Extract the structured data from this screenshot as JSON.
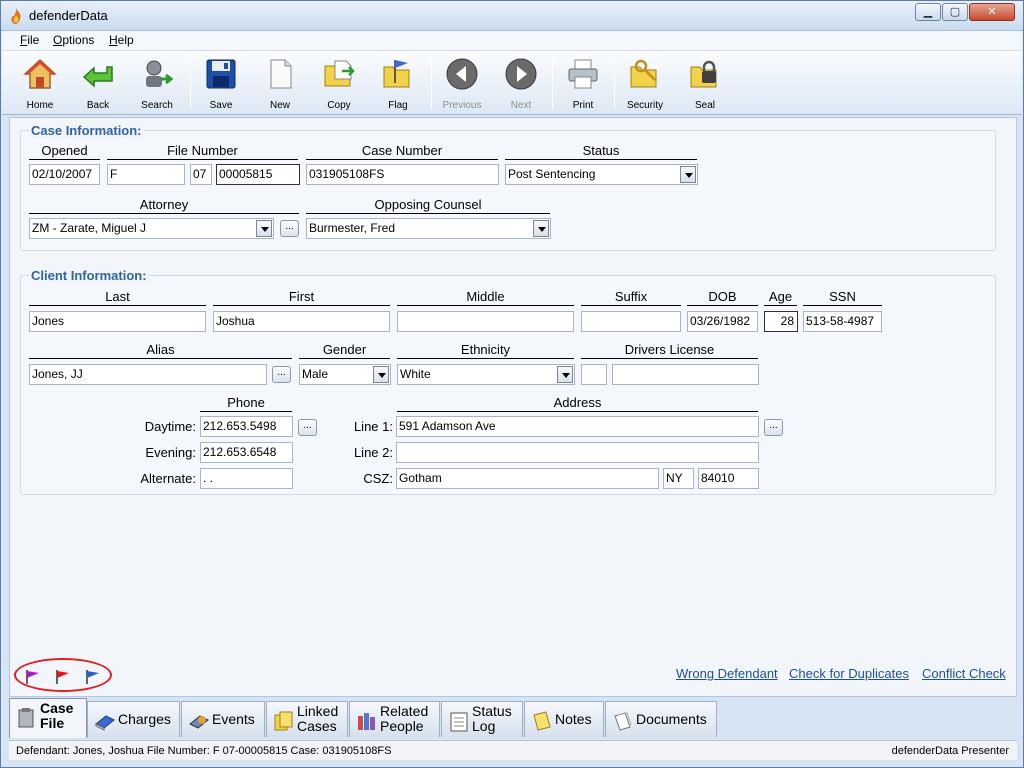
{
  "window": {
    "title": "defenderData"
  },
  "menu": [
    {
      "label": "File",
      "key": "F",
      "rest": "ile"
    },
    {
      "label": "Options",
      "key": "O",
      "rest": "ptions"
    },
    {
      "label": "Help",
      "key": "H",
      "rest": "elp"
    }
  ],
  "toolbar": {
    "home": "Home",
    "back": "Back",
    "search": "Search",
    "save": "Save",
    "new": "New",
    "copy": "Copy",
    "flag": "Flag",
    "previous": "Previous",
    "next": "Next",
    "print": "Print",
    "security": "Security",
    "seal": "Seal"
  },
  "case": {
    "title": "Case Information:",
    "opened_label": "Opened",
    "opened": "02/10/2007",
    "file_number_label": "File Number",
    "file_prefix": "F",
    "file_year": "07",
    "file_seq": "00005815",
    "case_number_label": "Case Number",
    "case_number": "031905108FS",
    "status_label": "Status",
    "status": "Post Sentencing",
    "attorney_label": "Attorney",
    "attorney": "ZM - Zarate, Miguel J",
    "opposing_label": "Opposing Counsel",
    "opposing": "Burmester, Fred"
  },
  "client": {
    "title": "Client Information:",
    "last_label": "Last",
    "last": "Jones",
    "first_label": "First",
    "first": "Joshua",
    "middle_label": "Middle",
    "middle": "",
    "suffix_label": "Suffix",
    "suffix": "",
    "dob_label": "DOB",
    "dob": "03/26/1982",
    "age_label": "Age",
    "age": "28",
    "ssn_label": "SSN",
    "ssn": "513-58-4987",
    "alias_label": "Alias",
    "alias": "Jones, JJ",
    "gender_label": "Gender",
    "gender": "Male",
    "ethnicity_label": "Ethnicity",
    "ethnicity": "White",
    "dl_label": "Drivers License",
    "dl_state": "",
    "dl_number": "",
    "phone_label": "Phone",
    "daytime_label": "Daytime:",
    "daytime": "212.653.5498",
    "evening_label": "Evening:",
    "evening": "212.653.6548",
    "alternate_label": "Alternate:",
    "alternate": "   .    .",
    "address_label": "Address",
    "line1_label": "Line 1:",
    "line1": "591 Adamson Ave",
    "line2_label": "Line 2:",
    "line2": "",
    "csz_label": "CSZ:",
    "city": "Gotham",
    "state": "NY",
    "zip": "84010",
    "dots": "..."
  },
  "links": {
    "wrong": "Wrong Defendant",
    "duplicates": "Check for Duplicates",
    "conflict": "Conflict Check"
  },
  "tabs": {
    "case_file_1": "Case",
    "case_file_2": "File",
    "charges": "Charges",
    "events": "Events",
    "linked_1": "Linked",
    "linked_2": "Cases",
    "related_1": "Related",
    "related_2": "People",
    "status_1": "Status",
    "status_2": "Log",
    "notes": "Notes",
    "documents": "Documents"
  },
  "status": {
    "left": "Defendant: Jones, Joshua  File Number: F  07-00005815  Case: 031905108FS",
    "right": "defenderData Presenter"
  },
  "colors": {
    "accent": "#2e63a6",
    "flag_purple": "#a020c8",
    "flag_red": "#e01818",
    "flag_blue": "#2a5fc0",
    "highlight_circle": "#e02020"
  }
}
